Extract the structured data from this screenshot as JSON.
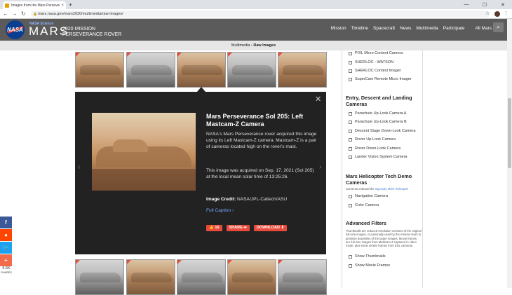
{
  "browser": {
    "tab_title": "Images from the Mars Perseverance Rover",
    "url": "mars.nasa.gov/mars2020/multimedia/raw-images/",
    "new_tab": "+",
    "close_tab": "×",
    "minimize": "—",
    "maximize": "☐",
    "close_window": "✕"
  },
  "header": {
    "logo_text": "NASA",
    "brand_small": "NASA Science",
    "brand_mars": "MARS",
    "mission_line1": "2020 MISSION",
    "mission_line2": "PERSEVERANCE ROVER",
    "nav": [
      "Mission",
      "Timeline",
      "Spacecraft",
      "News",
      "Multimedia",
      "Participate",
      "All Mars"
    ]
  },
  "breadcrumb": {
    "section": "Multimedia",
    "sep": " › ",
    "page": "Raw Images"
  },
  "lightbox": {
    "title": "Mars Perseverance Sol 205: Left Mastcam-Z Camera",
    "description": "NASA's Mars Perseverance rover acquired this image using its Left Mastcam-Z camera. Mastcam-Z is a pair of cameras located high on the rover's mast.",
    "acquired": "This image was acquired on Sep. 17, 2021 (Sol 205) at the local mean solar time of 13:25:26.",
    "credit_label": "Image Credit:",
    "credit_value": "NASA/JPL-Caltech/ASU",
    "full_caption": "Full Caption ›",
    "like_count": "16",
    "share_label": "SHARE",
    "download_label": "DOWNLOAD"
  },
  "sidebar": {
    "cameras_top": [
      "PIXL Micro Context Camera",
      "SHERLOC - WATSON",
      "SHERLOC Context Imager",
      "SuperCam Remote Micro Imager"
    ],
    "edl_heading": "Entry, Descent and Landing Cameras",
    "edl_cameras": [
      "Parachute Up-Look Camera A",
      "Parachute Up-Look Camera B",
      "Descent Stage Down-Look Camera",
      "Rover Up-Look Camera",
      "Rover Down-Look Camera",
      "Lander Vision System Camera"
    ],
    "heli_heading": "Mars Helicopter Tech Demo Cameras",
    "heli_note_prefix": "Cameras onboard the",
    "heli_note_link": "Ingenuity Mars Helicopter",
    "heli_cameras": [
      "Navigation Camera",
      "Color Camera"
    ],
    "advanced_heading": "Advanced Filters",
    "advanced_note": "Thumbnails are reduced-resolution versions of the original full-size images, occasionally used by the mission team to prioritize downlinks of the larger images. Movie frames are full-size images from Mastcam-Z captured in video mode, plus some similar frames from EDL cameras.",
    "advanced_filters": [
      "Show Thumbnails",
      "Show Movie Frames"
    ]
  },
  "share_bar": {
    "count": "6.6K",
    "label": "SHARES"
  }
}
